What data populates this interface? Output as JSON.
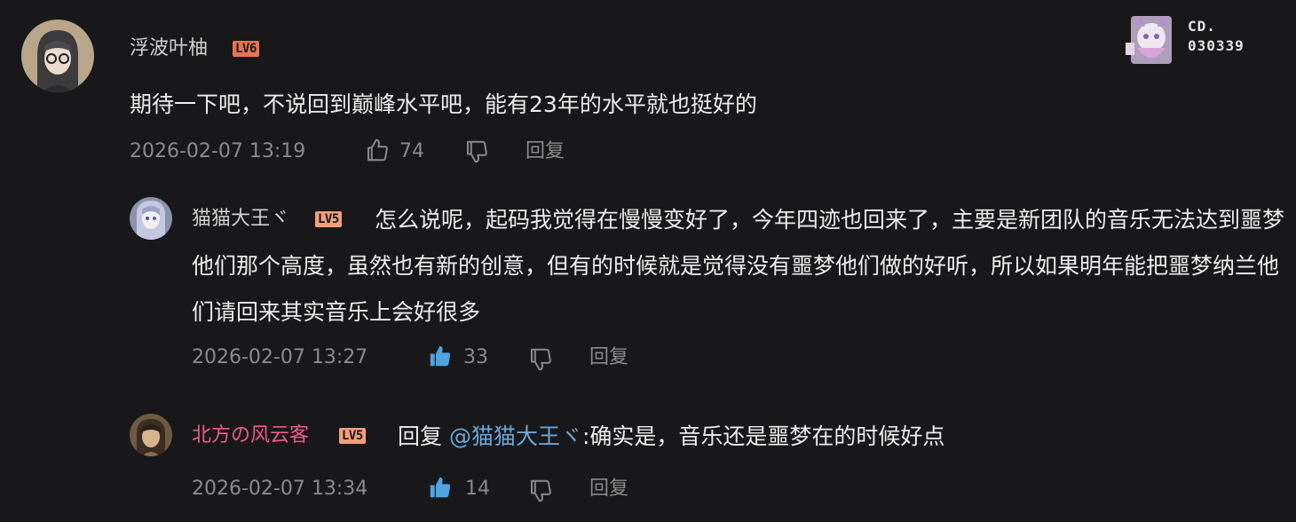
{
  "watermark": {
    "line1": "CD.",
    "line2": "030339"
  },
  "comments": [
    {
      "username": "浮波叶柚",
      "level": "LV6",
      "text": "期待一下吧，不说回到巅峰水平吧，能有23年的水平就也挺好的",
      "time": "2026-02-07 13:19",
      "likes": "74",
      "reply_label": "回复",
      "liked": false
    },
    {
      "username": "猫猫大王ヾ",
      "level": "LV5",
      "text": "怎么说呢，起码我觉得在慢慢变好了，今年四迹也回来了，主要是新团队的音乐无法达到噩梦他们那个高度，虽然也有新的创意，但有的时候就是觉得没有噩梦他们做的好听，所以如果明年能把噩梦纳兰他们请回来其实音乐上会好很多",
      "time": "2026-02-07 13:27",
      "likes": "33",
      "reply_label": "回复",
      "liked": true
    },
    {
      "username": "北方の风云客",
      "level": "LV5",
      "reply_prefix": "回复",
      "mention": "@猫猫大王ヾ",
      "text": ":确实是，音乐还是噩梦在的时候好点",
      "time": "2026-02-07 13:34",
      "likes": "14",
      "reply_label": "回复",
      "liked": true
    }
  ],
  "colors": {
    "background": "#18181a",
    "username_default": "#cfcfcf",
    "username_vip": "#f05a86",
    "mention": "#6aa6d9",
    "level_badge": "#e8744f",
    "like_active": "#4fa3e0",
    "meta": "#8a8a8a"
  }
}
